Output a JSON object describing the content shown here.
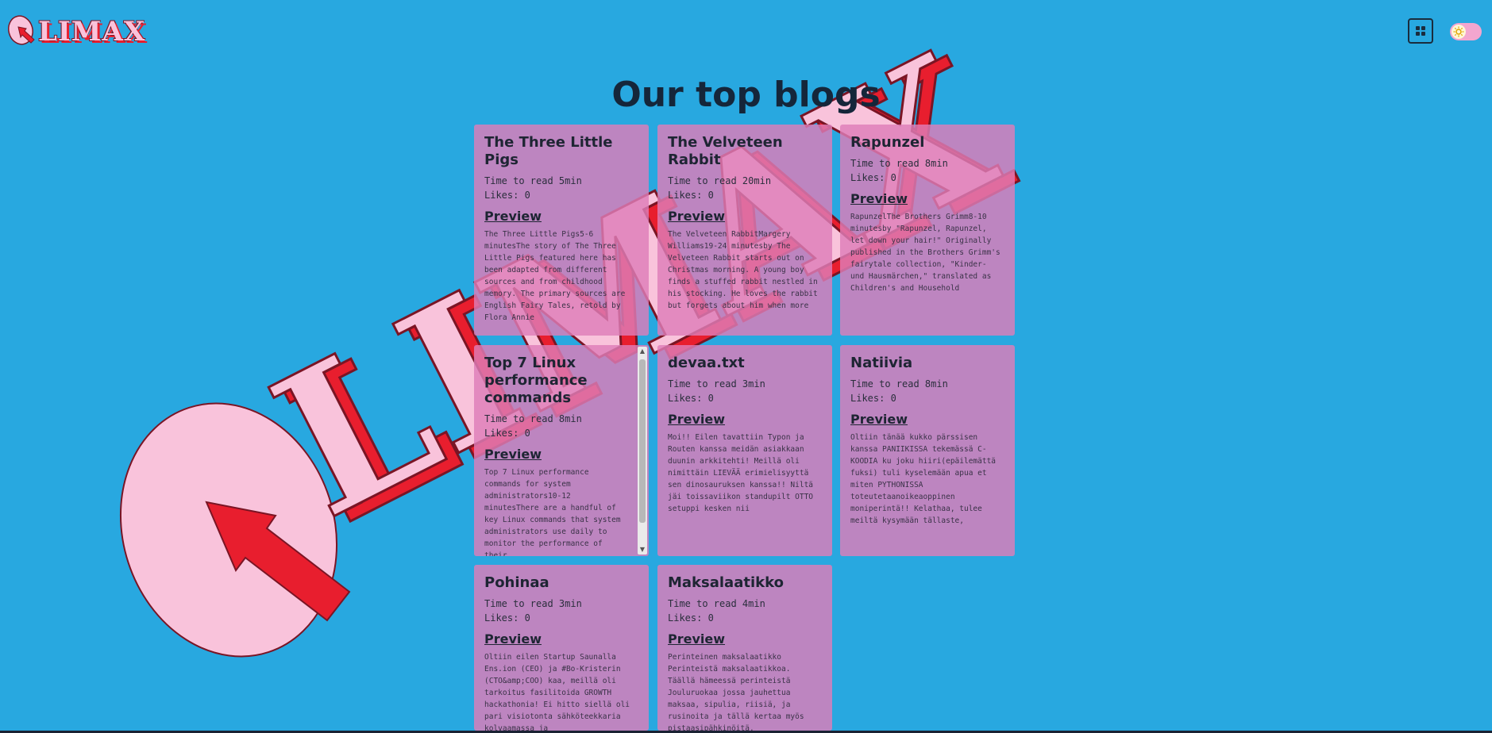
{
  "brand": {
    "name": "LIMAX",
    "watermark": "LIMAX"
  },
  "colors": {
    "background": "#28a8e0",
    "card": "#de7eb8",
    "logo_pink": "#f9c3db",
    "logo_red": "#e81e2e"
  },
  "header": {
    "grid_icon": "grid-icon",
    "theme_icon": "sun-icon"
  },
  "page": {
    "title": "Our top blogs"
  },
  "blogs": [
    {
      "title": "The Three Little Pigs",
      "read_time": "Time to read 5min",
      "likes": "Likes: 0",
      "preview": "Preview",
      "excerpt": "The Three Little Pigs5-6 minutesThe story of The Three Little Pigs featured here has been adapted from different sources and from childhood memory. The primary sources are English Fairy Tales, retold by Flora Annie"
    },
    {
      "title": "The Velveteen Rabbit",
      "read_time": "Time to read 20min",
      "likes": "Likes: 0",
      "preview": "Preview",
      "excerpt": "The Velveteen RabbitMargery Williams19-24 minutesby The Velveteen Rabbit starts out on Christmas morning. A young boy finds a stuffed rabbit nestled in his stocking. He loves the rabbit but forgets about him when more"
    },
    {
      "title": "Rapunzel",
      "read_time": "Time to read 8min",
      "likes": "Likes: 0",
      "preview": "Preview",
      "excerpt": "RapunzelThe Brothers Grimm8-10 minutesby \"Rapunzel, Rapunzel, let down your hair!\" Originally published in the Brothers Grimm's fairytale collection, \"Kinder- und Hausmärchen,\" translated as Children's and Household"
    },
    {
      "title": "Top 7 Linux performance commands",
      "read_time": "Time to read 8min",
      "likes": "Likes: 0",
      "preview": "Preview",
      "excerpt": "Top 7 Linux performance commands for system administrators10-12 minutesThere are a handful of key Linux commands that system administrators use daily to monitor the performance of their"
    },
    {
      "title": "devaa.txt",
      "read_time": "Time to read 3min",
      "likes": "Likes: 0",
      "preview": "Preview",
      "excerpt": "Moi!! Eilen tavattiin Typon ja Routen kanssa meidän asiakkaan duunin arkkitehti! Meillä oli nimittäin LIEVÄÄ erimielisyyttä sen dinosauruksen kanssa!! Niltä jäi toissaviikon standupilt OTTO setuppi kesken nii"
    },
    {
      "title": "Natiivia",
      "read_time": "Time to read 8min",
      "likes": "Likes: 0",
      "preview": "Preview",
      "excerpt": "Oltiin tänää kukko pärssisen kanssa PANIIKISSA tekemässä C-KOODIA ku joku hiiri(epäilemättä fuksi) tuli kyselemään apua et miten PYTHONISSA toteutetaanoikeaoppinen moniperintä!! Kelathaa, tulee meiltä kysymään tällaste,"
    },
    {
      "title": "Pohinaa",
      "read_time": "Time to read 3min",
      "likes": "Likes: 0",
      "preview": "Preview",
      "excerpt": "Oltiin eilen Startup Saunalla Ens.ion (CEO) ja #Bo-Kristerin (CTO&amp;COO) kaa, meillä oli tarkoitus fasilitoida GROWTH hackathonia! Ei hitto siellä oli pari visiotonta sähköteekkaria kolvaamassa ja"
    },
    {
      "title": "Maksalaatikko",
      "read_time": "Time to read 4min",
      "likes": "Likes: 0",
      "preview": "Preview",
      "excerpt": "Perinteinen maksalaatikko Perinteistä maksalaatikkoa. Täällä hämeessä perinteistä Jouluruokaa jossa jauhettua maksaa, sipulia, riisiä, ja rusinoita ja tällä kertaa myös pistaasipähkinöitä."
    }
  ]
}
